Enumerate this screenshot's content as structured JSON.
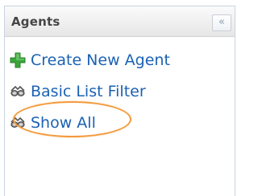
{
  "panel": {
    "title": "Agents",
    "collapse_glyph": "«",
    "items": [
      {
        "label": "Create New Agent",
        "icon": "add-icon"
      },
      {
        "label": "Basic List Filter",
        "icon": "binoculars-icon"
      },
      {
        "label": "Show All",
        "icon": "binoculars-icon"
      }
    ]
  },
  "colors": {
    "link": "#1b62b3",
    "add_icon": "#3aa63a",
    "highlight": "#f39a3b"
  }
}
